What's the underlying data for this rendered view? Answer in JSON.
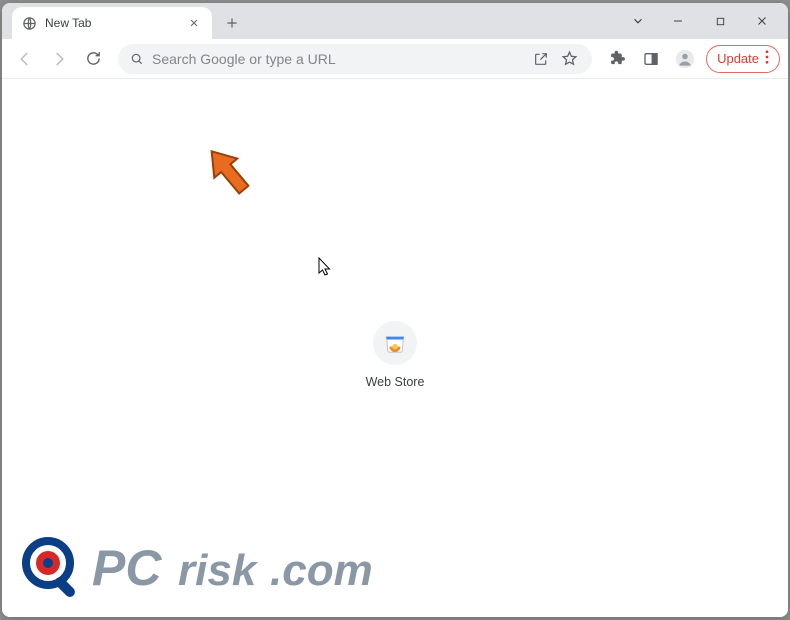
{
  "tab": {
    "title": "New Tab"
  },
  "omnibox": {
    "placeholder": "Search Google or type a URL"
  },
  "toolbar": {
    "update_label": "Update"
  },
  "shortcut": {
    "label": "Web Store"
  },
  "watermark": {
    "text": "PCrisk.com"
  },
  "icons": {
    "globe": "globe-icon",
    "close": "close-icon",
    "plus": "plus-icon",
    "chevron_down": "chevron-down-icon",
    "minimize": "minimize-icon",
    "maximize": "maximize-icon",
    "window_close": "window-close-icon",
    "back": "back-icon",
    "forward": "forward-icon",
    "reload": "reload-icon",
    "search": "search-icon",
    "share": "share-icon",
    "star": "star-icon",
    "extensions": "extensions-icon",
    "sidepanel": "sidepanel-icon",
    "profile": "profile-icon",
    "menu": "menu-icon",
    "webstore": "webstore-icon"
  }
}
